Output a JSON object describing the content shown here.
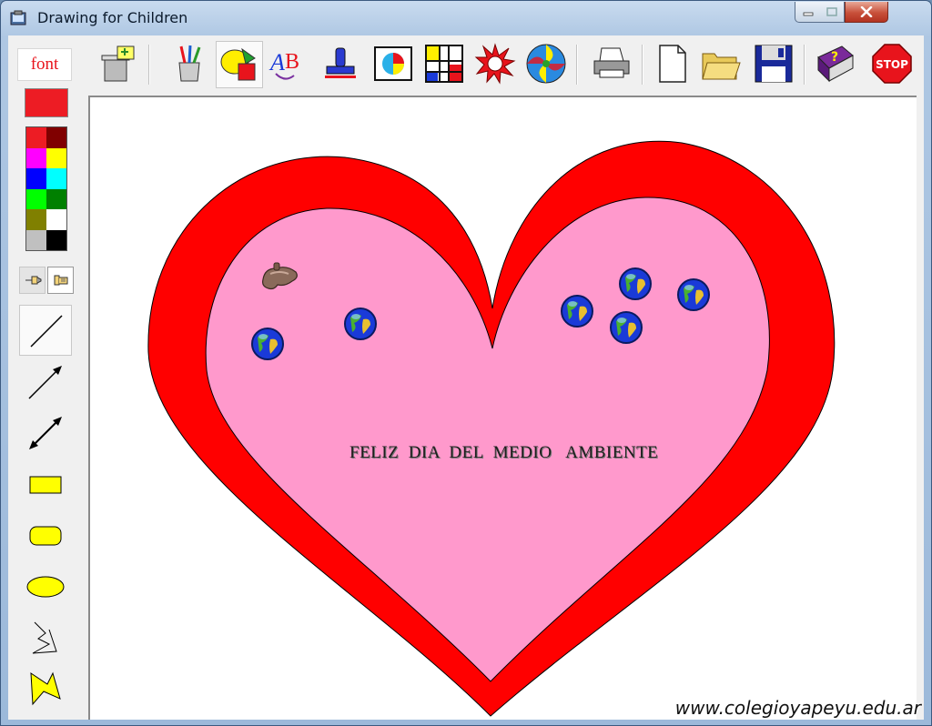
{
  "window": {
    "title": "Drawing for Children"
  },
  "left_toolbar": {
    "font_button_label": "font",
    "current_color": "#ed1c24",
    "palette": [
      "#ed1c24",
      "#800000",
      "#ff00ff",
      "#ffff00",
      "#0000ff",
      "#00ffff",
      "#00ff00",
      "#008000",
      "#808000",
      "#ffffff",
      "#c0c0c0",
      "#000000"
    ],
    "tools": [
      "line-tool",
      "arrow-tool",
      "double-arrow-tool",
      "rectangle-tool",
      "rounded-rectangle-tool",
      "ellipse-tool",
      "polyline-tool",
      "filled-polygon-tool"
    ]
  },
  "top_toolbar": {
    "buttons": [
      "clear-icon",
      "pencils-icon",
      "shapes-icon",
      "text-icon",
      "stamp-icon",
      "picture-frame-icon",
      "grid-icon",
      "starburst-icon",
      "swirl-ball-icon",
      "print-icon",
      "new-file-icon",
      "open-folder-icon",
      "save-disk-icon",
      "help-book-icon",
      "stop-icon"
    ],
    "stop_label": "STOP"
  },
  "canvas": {
    "heart_outer_color": "#ff0000",
    "heart_inner_color": "#ff99cc",
    "message": "FELIZ  DIA  DEL  MEDIO   AMBIENTE",
    "stickers": [
      "globe",
      "globe",
      "globe",
      "globe",
      "globe",
      "globe",
      "rock"
    ]
  },
  "watermark": "www.colegioyapeyu.edu.ar"
}
